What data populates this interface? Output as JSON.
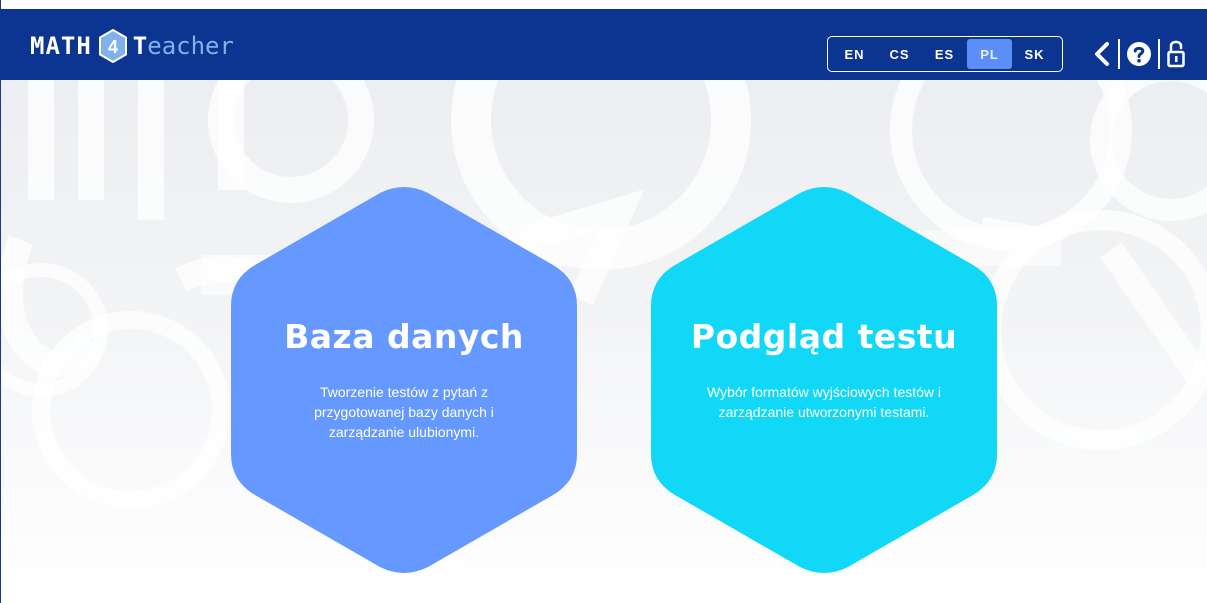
{
  "brand": {
    "logo_math": "MATH",
    "logo_digit": "4",
    "logo_t": "T",
    "logo_rest": "eacher"
  },
  "languages": {
    "items": [
      "EN",
      "CS",
      "ES",
      "PL",
      "SK"
    ],
    "active": "PL"
  },
  "header_icons": [
    "back-icon",
    "help-icon",
    "lock-icon"
  ],
  "cards": [
    {
      "title": "Baza danych",
      "description": "Tworzenie testów z pytań z przygotowanej bazy danych i zarządzanie ulubionymi.",
      "color": "#6699ff"
    },
    {
      "title": "Podgląd testu",
      "description": "Wybór formatów wyjściowych testów i zarządzanie utworzonymi testami.",
      "color": "#10d8f6"
    }
  ],
  "colors": {
    "header_bg": "#0b3590",
    "lang_active_bg": "#5b8ff5",
    "logo_accent": "#7fb1ea"
  }
}
